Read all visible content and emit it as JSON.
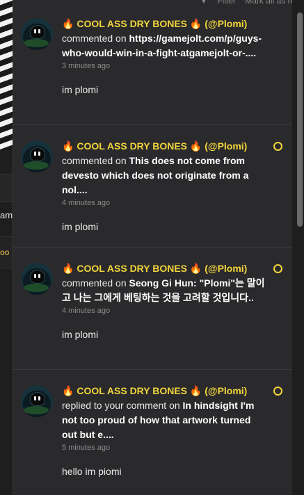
{
  "toolbar": {
    "filter_label": "Filter",
    "mark_all_label": "Mark all as read"
  },
  "background": {
    "text1": "ame",
    "text2": "oo"
  },
  "notifications": [
    {
      "fire1": "🔥",
      "user_name": "COOL ASS DRY BONES",
      "fire2": "🔥",
      "handle": "(@Plomi)",
      "action": "commented on",
      "target": "https://gamejolt.com/p/guys-who-would-win-in-a-fight-atgamejolt-or-....",
      "time": "3 minutes ago",
      "body": "im plomi",
      "unread": false
    },
    {
      "fire1": "🔥",
      "user_name": "COOL ASS DRY BONES",
      "fire2": "🔥",
      "handle": "(@Plomi)",
      "action": "commented on",
      "target": "This does not come from devesto which does not originate from a nol....",
      "time": "4 minutes ago",
      "body": "im plomi",
      "unread": true
    },
    {
      "fire1": "🔥",
      "user_name": "COOL ASS DRY BONES",
      "fire2": "🔥",
      "handle": "(@Plomi)",
      "action": "commented on",
      "target": "Seong Gi Hun: \"Plomi\"는 말이고 나는 그에게 베팅하는 것을 고려할 것입니다..",
      "time": "4 minutes ago",
      "body": "im plomi",
      "unread": true
    },
    {
      "fire1": "🔥",
      "user_name": "COOL ASS DRY BONES",
      "fire2": "🔥",
      "handle": "(@Plomi)",
      "action": "replied to your comment on",
      "target": "In hindsight I'm not too proud of how that artwork turned out but e....",
      "time": "5 minutes ago",
      "body": "hello im piomi",
      "unread": true
    }
  ],
  "icons": {
    "fire": "fire-icon",
    "unread": "unread-dot-icon",
    "avatar": "avatar-dry-bones"
  },
  "colors": {
    "accent": "#f2d53c",
    "panel_bg": "#2a2a2c",
    "divider": "#3c3c3c"
  }
}
